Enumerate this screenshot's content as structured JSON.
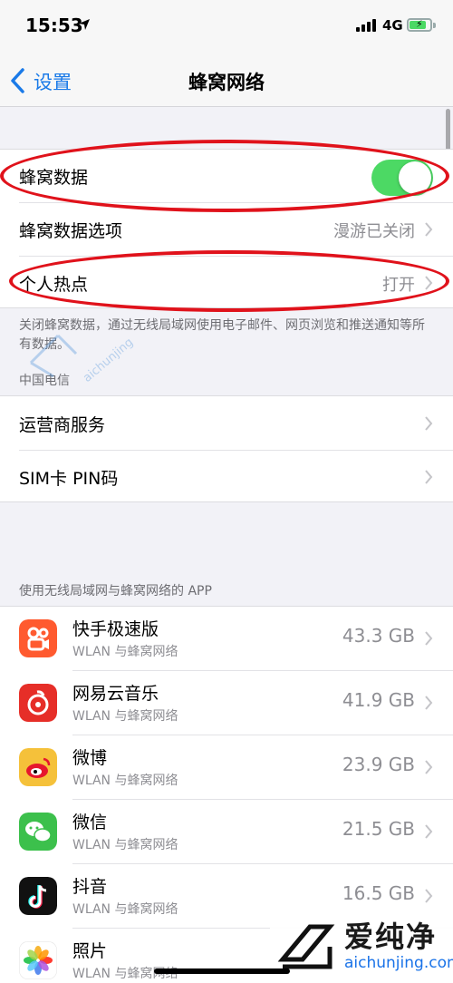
{
  "status_bar": {
    "time": "15:53",
    "network": "4G"
  },
  "nav": {
    "back_label": "设置",
    "title": "蜂窝网络"
  },
  "settings_group": {
    "cellular_data_label": "蜂窝数据",
    "cellular_data_on": true,
    "cellular_options_label": "蜂窝数据选项",
    "cellular_options_value": "漫游已关闭",
    "hotspot_label": "个人热点",
    "hotspot_value": "打开"
  },
  "note": "关闭蜂窝数据，通过无线局域网使用电子邮件、网页浏览和推送通知等所有数据。",
  "carrier_section": {
    "header": "中国电信",
    "carrier_services_label": "运营商服务",
    "sim_pin_label": "SIM卡 PIN码"
  },
  "apps_section": {
    "header": "使用无线局域网与蜂窝网络的 APP",
    "apps": [
      {
        "name": "快手极速版",
        "sub": "WLAN 与蜂窝网络",
        "size": "43.3 GB",
        "icon": "kuaishou-icon",
        "color": "#ff5a2f"
      },
      {
        "name": "网易云音乐",
        "sub": "WLAN 与蜂窝网络",
        "size": "41.9 GB",
        "icon": "netease-music-icon",
        "color": "#e62e28"
      },
      {
        "name": "微博",
        "sub": "WLAN 与蜂窝网络",
        "size": "23.9 GB",
        "icon": "weibo-icon",
        "color": "#f5c13a"
      },
      {
        "name": "微信",
        "sub": "WLAN 与蜂窝网络",
        "size": "21.5 GB",
        "icon": "wechat-icon",
        "color": "#3cc04c"
      },
      {
        "name": "抖音",
        "sub": "WLAN 与蜂窝网络",
        "size": "16.5 GB",
        "icon": "douyin-icon",
        "color": "#111111"
      },
      {
        "name": "照片",
        "sub": "WLAN 与蜂窝网络",
        "size": "",
        "icon": "photos-icon",
        "color": "#ffffff"
      }
    ]
  },
  "watermark": {
    "name": "爱纯净",
    "url": "aichunjing.com",
    "mid_text": "aichunjing"
  },
  "colors": {
    "accent": "#1a7ae8",
    "toggle_on": "#4cd964",
    "annotation_red": "#e0121b"
  }
}
